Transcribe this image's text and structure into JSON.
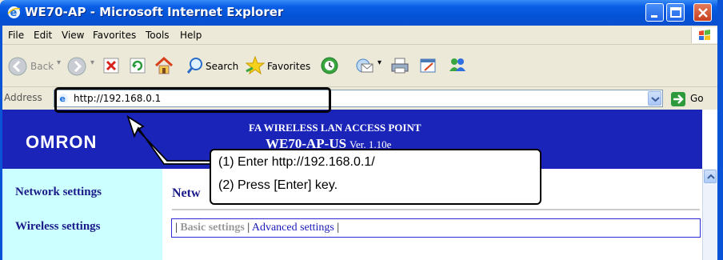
{
  "window": {
    "title": "WE70-AP - Microsoft Internet Explorer"
  },
  "menu": [
    "File",
    "Edit",
    "View",
    "Favorites",
    "Tools",
    "Help"
  ],
  "toolbar": {
    "back_label": "Back",
    "search_label": "Search",
    "favorites_label": "Favorites"
  },
  "address": {
    "label": "Address",
    "value": "http://192.168.0.1",
    "go_label": "Go"
  },
  "page": {
    "logo": "OMRON",
    "header_title": "FA WIRELESS LAN ACCESS POINT",
    "model": "WE70-AP-US",
    "version": "Ver. 1.10e",
    "nav": [
      "Network settings",
      "Wireless settings"
    ],
    "main_heading": "Netw",
    "tabs": {
      "basic": "Basic settings",
      "advanced": "Advanced settings"
    }
  },
  "callout": {
    "line1": "(1) Enter http://192.168.0.1/",
    "line2": "(2) Press [Enter] key."
  },
  "colors": {
    "title_bar": "#0453d6",
    "header_band": "#1a24b8",
    "sidebar": "#ccffff",
    "nav_text": "#1a1a8a"
  }
}
